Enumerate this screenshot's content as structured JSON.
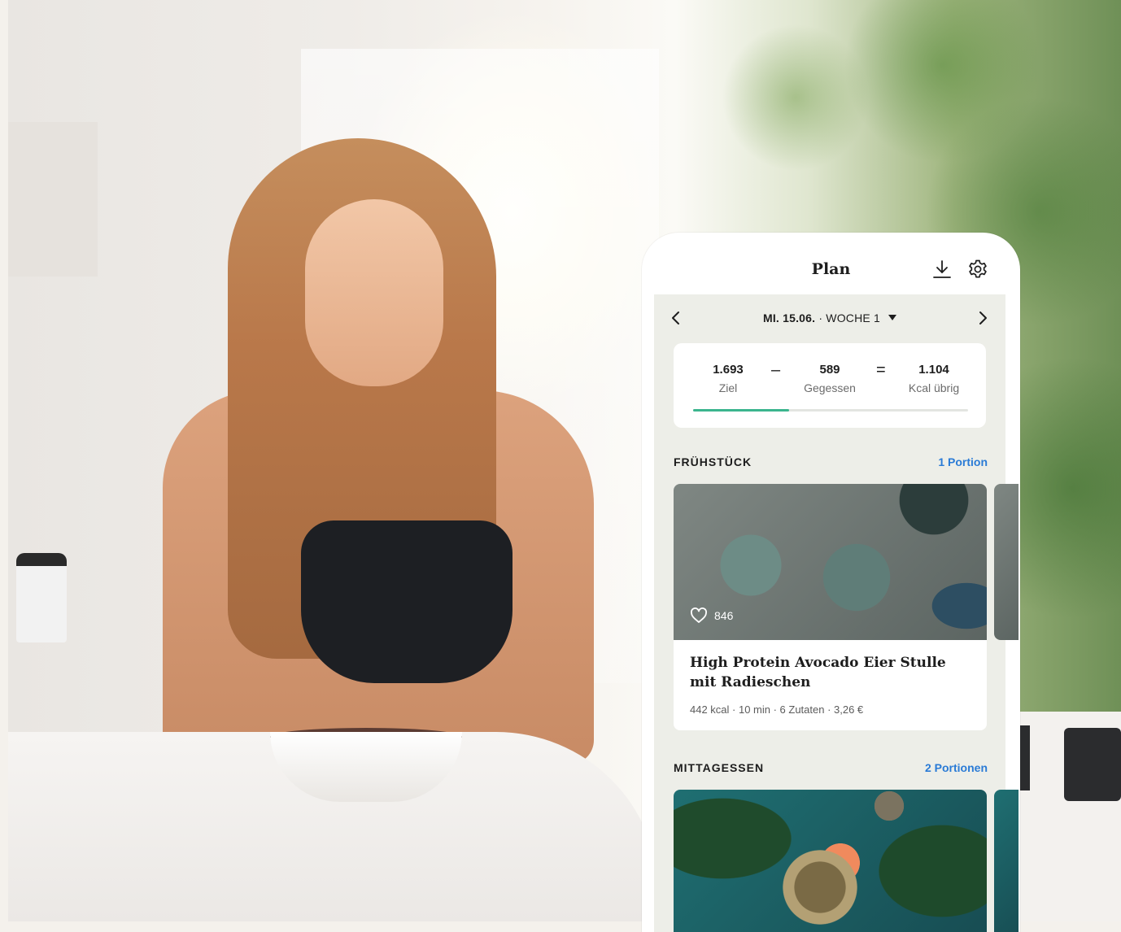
{
  "app": {
    "title": "Plan",
    "icons": {
      "download": "download-icon",
      "settings": "gear-icon"
    }
  },
  "date_nav": {
    "date": "MI. 15.06.",
    "week": " · WOCHE 1",
    "prev_icon": "chevron-left-icon",
    "next_icon": "chevron-right-icon"
  },
  "kcal": {
    "goal_value": "1.693",
    "goal_label": "Ziel",
    "minus": "–",
    "eaten_value": "589",
    "eaten_label": "Gegessen",
    "equals": "=",
    "left_value": "1.104",
    "left_label": "Kcal übrig",
    "progress_fraction": 0.348,
    "accent_color": "#3bb58e"
  },
  "breakfast": {
    "title": "FRÜHSTÜCK",
    "portions": "1 Portion",
    "recipe": {
      "likes": "846",
      "name": "High Protein Avocado Eier Stulle mit Radieschen",
      "meta": "442 kcal · 10 min · 6 Zutaten · 3,26 €"
    }
  },
  "lunch": {
    "title": "MITTAGESSEN",
    "portions": "2 Portionen"
  },
  "colors": {
    "link": "#2a7bd6",
    "plan_background": "#edeee8"
  }
}
